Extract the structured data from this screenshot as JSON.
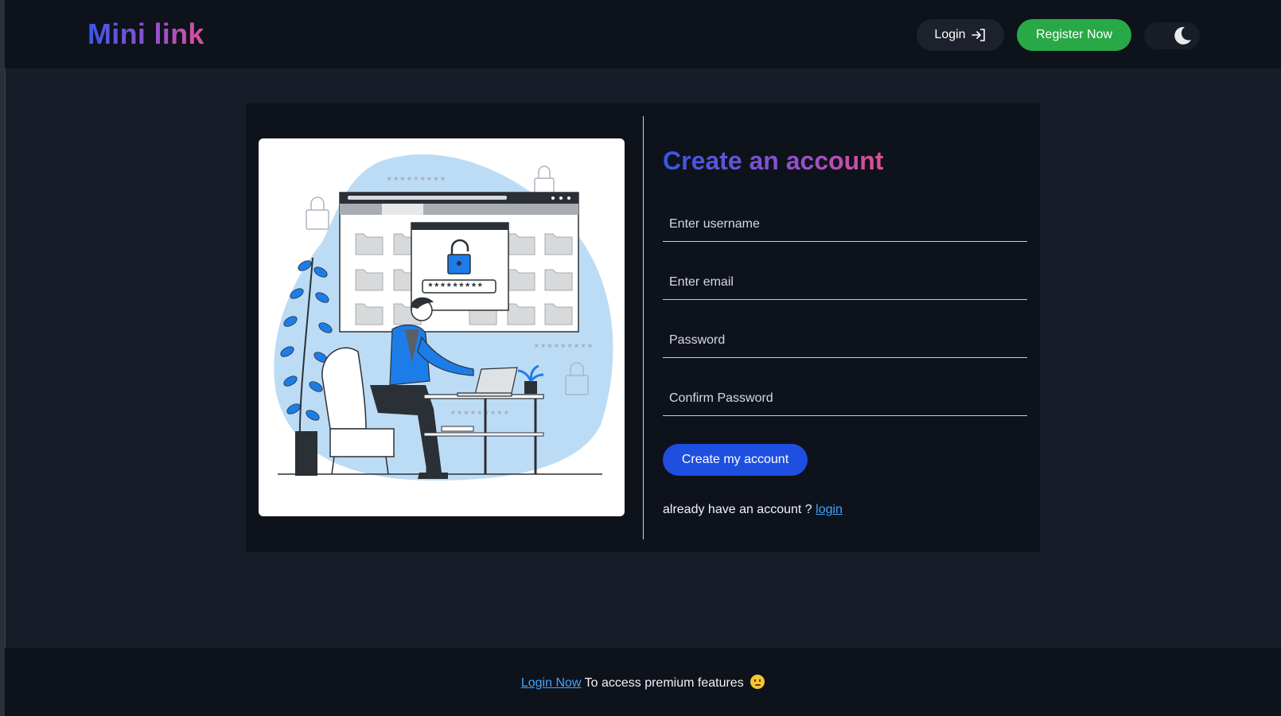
{
  "app": {
    "logo": "Mini link"
  },
  "nav": {
    "login_label": "Login",
    "register_label": "Register Now",
    "theme_icon": "moon-icon"
  },
  "illustration": {
    "password_mask": "*********",
    "icons": [
      "lock-icon",
      "folder-icon",
      "laptop-icon",
      "plant-icon"
    ]
  },
  "form": {
    "title": "Create an account",
    "fields": {
      "username": {
        "placeholder": "Enter username",
        "value": ""
      },
      "email": {
        "placeholder": "Enter email",
        "value": ""
      },
      "password": {
        "placeholder": "Password",
        "value": ""
      },
      "confirm": {
        "placeholder": "Confirm Password",
        "value": ""
      }
    },
    "submit_label": "Create my account",
    "already_text": "already have an account ?",
    "login_link": "login"
  },
  "footer": {
    "login_link": "Login Now",
    "text": "To access premium features",
    "emoji": "neutral-face-icon"
  },
  "colors": {
    "page_bg": "#171c28",
    "panel_bg": "#0e121b",
    "register_green": "#29a847",
    "primary_blue": "#1f4fe0",
    "link_blue": "#3ea6ff",
    "illustration_blue": "#1d7de8",
    "blob_light_blue": "#bcdcf5"
  }
}
